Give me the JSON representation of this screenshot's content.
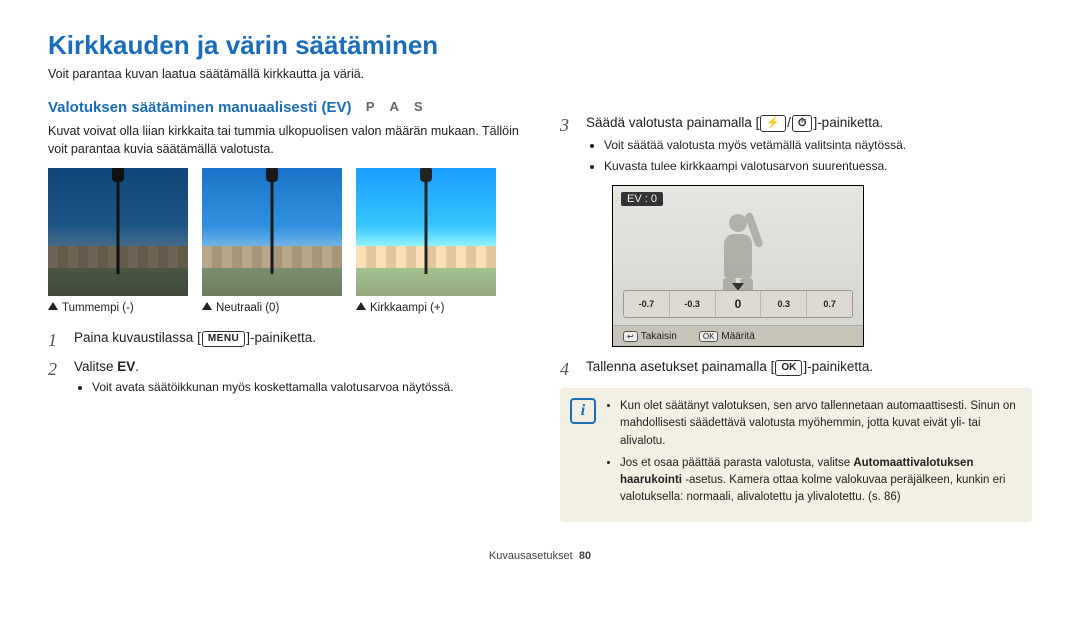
{
  "title": "Kirkkauden ja värin säätäminen",
  "subtitle": "Voit parantaa kuvan laatua säätämällä kirkkautta ja väriä.",
  "left": {
    "heading": "Valotuksen säätäminen manuaalisesti (EV)",
    "modes": "P A S",
    "desc": "Kuvat voivat olla liian kirkkaita tai tummia ulkopuolisen valon määrän mukaan. Tällöin voit parantaa kuvia säätämällä valotusta.",
    "thumbs": [
      {
        "caption": "Tummempi (-)"
      },
      {
        "caption": "Neutraali (0)"
      },
      {
        "caption": "Kirkkaampi (+)"
      }
    ],
    "step1_a": "Paina kuvaustilassa [",
    "step1_kbd": "MENU",
    "step1_b": "]-painiketta.",
    "step2_a": "Valitse ",
    "step2_b": "EV",
    "step2_c": ".",
    "step2_sub1": "Voit avata säätöikkunan myös koskettamalla valotusarvoa näytössä."
  },
  "right": {
    "step3_a": "Säädä valotusta painamalla [",
    "step3_mid": "/",
    "step3_b": "]-painiketta.",
    "step3_sub1": "Voit säätää valotusta myös vetämällä valitsinta näytössä.",
    "step3_sub2": "Kuvasta tulee kirkkaampi valotusarvon suurentuessa.",
    "ev_label": "EV : 0",
    "ev_ticks": [
      "-0.7",
      "-0.3",
      "0",
      "0.3",
      "0.7"
    ],
    "ev_back_icon": "↩",
    "ev_back_label": "Takaisin",
    "ev_ok_icon": "OK",
    "ev_ok_label": "Määritä",
    "step4_a": "Tallenna asetukset painamalla [",
    "step4_kbd": "OK",
    "step4_b": "]-painiketta.",
    "note1_a": "Kun olet säätänyt valotuksen, sen arvo tallennetaan automaattisesti. Sinun on mahdollisesti säädettävä valotusta myöhemmin, jotta kuvat eivät yli- tai alivalotu.",
    "note2_a": "Jos et osaa päättää parasta valotusta, valitse ",
    "note2_b": "Automaattivalotuksen haarukointi",
    "note2_c": " -asetus. Kamera ottaa kolme valokuvaa peräjälkeen, kunkin eri valotuksella: normaali, alivalotettu ja ylivalotettu. (s. 86)"
  },
  "footer_a": "Kuvausasetukset",
  "footer_b": "80"
}
